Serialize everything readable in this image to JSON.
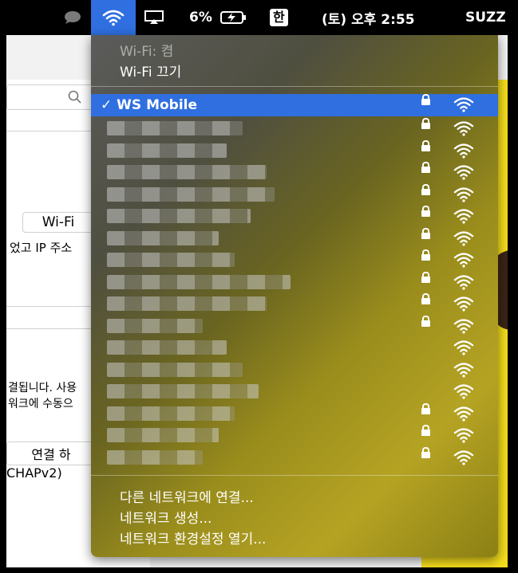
{
  "menubar": {
    "battery_pct": "6%",
    "input_source": "한",
    "clock": "(토) 오후 2:55",
    "username": "SUZZ"
  },
  "wifi_menu": {
    "status": "Wi-Fi: 켬",
    "toggle_label": "Wi-Fi 끄기",
    "selected_network": "✓ WS Mobile",
    "networks": [
      {
        "locked": true
      },
      {
        "locked": true
      },
      {
        "locked": true
      },
      {
        "locked": true
      },
      {
        "locked": true
      },
      {
        "locked": true
      },
      {
        "locked": true
      },
      {
        "locked": true
      },
      {
        "locked": true
      },
      {
        "locked": true
      },
      {
        "locked": false
      },
      {
        "locked": false
      },
      {
        "locked": false
      },
      {
        "locked": true
      },
      {
        "locked": true
      },
      {
        "locked": true
      }
    ],
    "join_other": "다른 네트워크에 연결...",
    "create_network": "네트워크 생성...",
    "open_prefs": "네트워크 환경설정 열기..."
  },
  "background_window": {
    "wifi_button": "Wi-Fi",
    "ip_text": "었고 IP 주소",
    "info_line1": "결됩니다. 사용",
    "info_line2": "워크에 수동으",
    "connect_button": "연결 하",
    "eap_text": "CHAPv2)"
  },
  "colors": {
    "selection_blue": "#2f6fe0",
    "yellow_background": "#f5dd1c"
  }
}
